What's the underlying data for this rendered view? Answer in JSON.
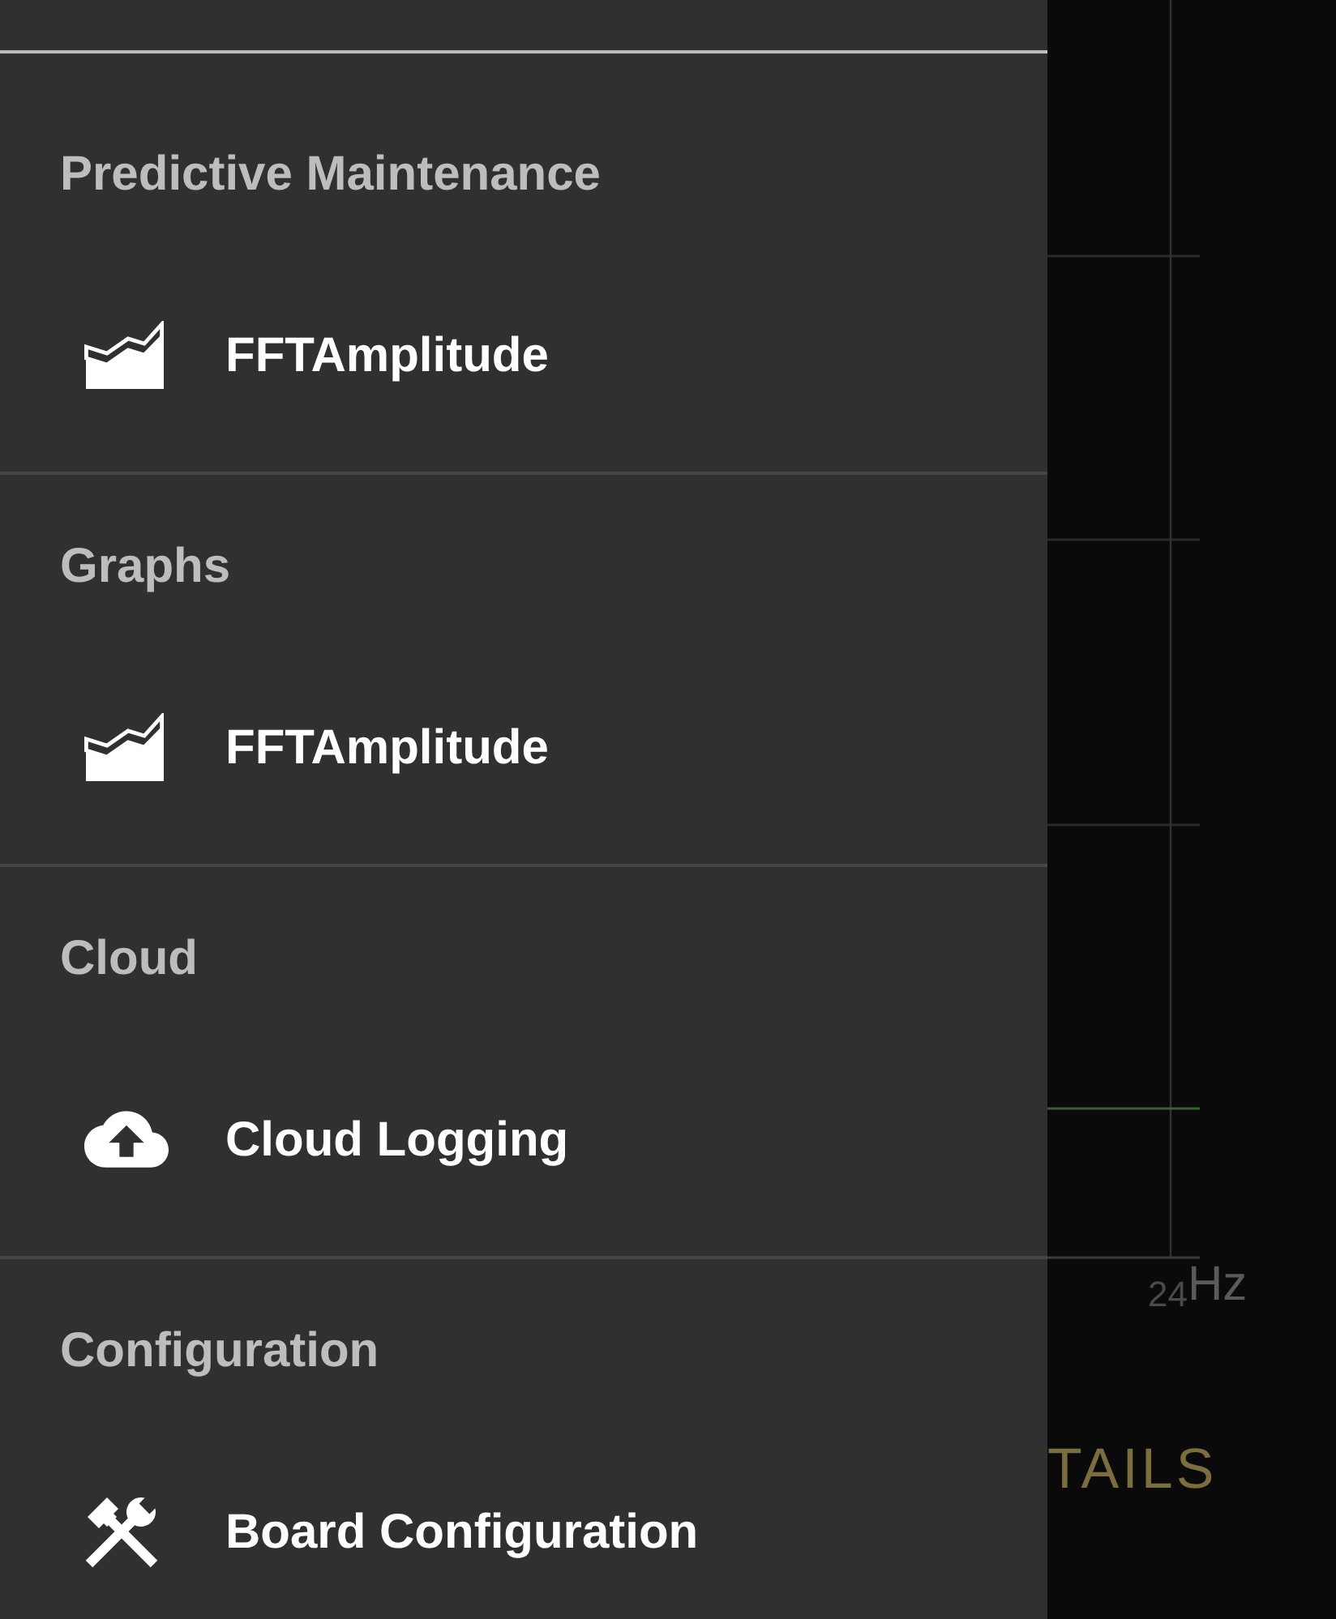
{
  "drawer": {
    "sections": [
      {
        "title": "Predictive Maintenance",
        "items": [
          {
            "label": "FFTAmplitude",
            "kind": "chart"
          }
        ]
      },
      {
        "title": "Graphs",
        "items": [
          {
            "label": "FFTAmplitude",
            "kind": "chart"
          }
        ]
      },
      {
        "title": "Cloud",
        "items": [
          {
            "label": "Cloud Logging",
            "kind": "cloud"
          }
        ]
      },
      {
        "title": "Configuration",
        "items": [
          {
            "label": "Board Configuration",
            "kind": "tools"
          }
        ]
      }
    ]
  },
  "background": {
    "chart": {
      "tick": "24",
      "axis_label": "Hz"
    },
    "button": "TAILS"
  }
}
